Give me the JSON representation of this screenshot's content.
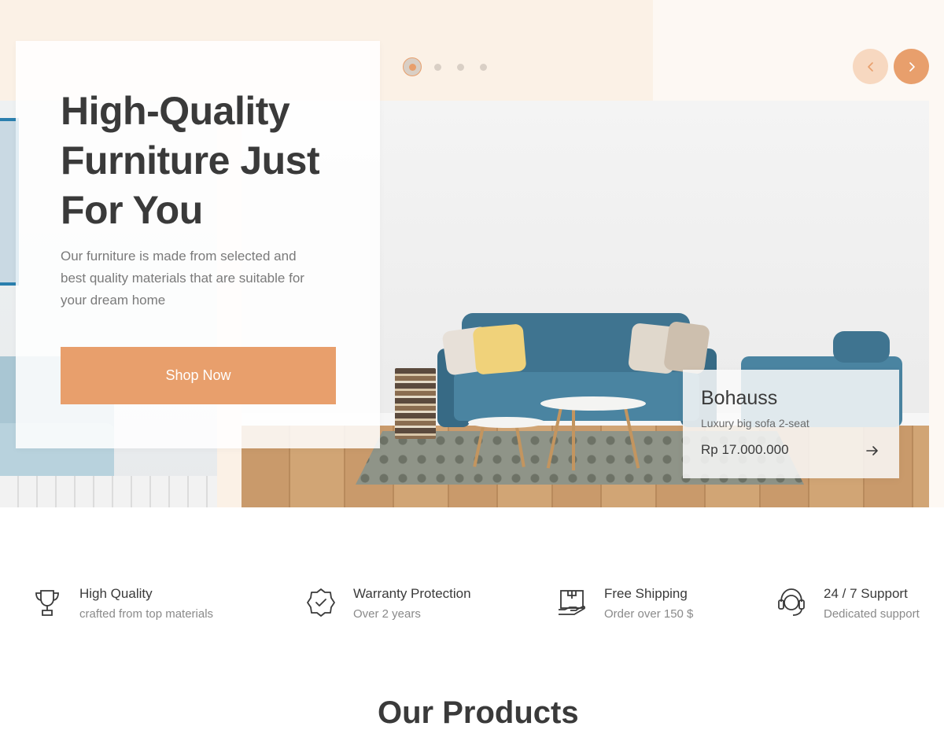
{
  "hero": {
    "title": "High-Quality Furniture Just For You",
    "description": "Our furniture is made from selected and best quality materials that are suitable for your dream home",
    "cta_label": "Shop Now"
  },
  "carousel": {
    "slide_count": 4,
    "active_index": 0,
    "prev_icon": "chevron-left-icon",
    "next_icon": "chevron-right-icon"
  },
  "product": {
    "name": "Bohauss",
    "subtitle": "Luxury big sofa 2-seat",
    "price": "Rp 17.000.000",
    "arrow_icon": "arrow-right-icon"
  },
  "features": [
    {
      "icon": "trophy-icon",
      "title": "High Quality",
      "subtitle": "crafted from top materials"
    },
    {
      "icon": "badge-check-icon",
      "title": "Warranty Protection",
      "subtitle": "Over 2 years"
    },
    {
      "icon": "shipping-box-icon",
      "title": "Free Shipping",
      "subtitle": "Order over 150 $"
    },
    {
      "icon": "headset-support-icon",
      "title": "24 / 7 Support",
      "subtitle": "Dedicated support"
    }
  ],
  "next_section_title_partial": "Our Products",
  "colors": {
    "accent": "#e89f6c",
    "accent_light": "#f7d8c0",
    "cream": "#fbf1e6",
    "text_dark": "#3a3a3a",
    "text_muted": "#7a7a7a"
  }
}
